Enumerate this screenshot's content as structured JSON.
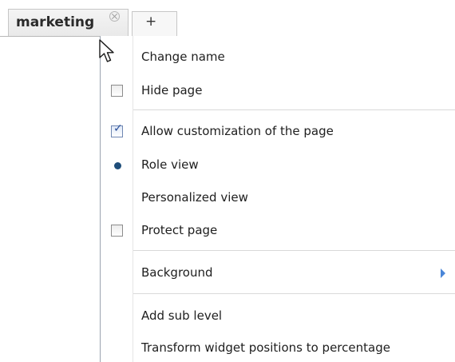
{
  "tabs": {
    "active_label": "marketing",
    "add_label": "+"
  },
  "menu": {
    "items": {
      "change_name": "Change name",
      "hide_page": "Hide page",
      "allow_customization": "Allow customization of the page",
      "role_view": "Role view",
      "personalized_view": "Personalized view",
      "protect_page": "Protect page",
      "background": "Background",
      "add_sub_level": "Add sub level",
      "transform_widget": "Transform widget positions to percentage"
    },
    "state": {
      "hide_page_checked": false,
      "allow_customization_checked": true,
      "role_view_selected": true,
      "protect_page_checked": false
    }
  },
  "colors": {
    "radio_dot": "#1f4e7a",
    "submenu_arrow": "#4a86d8",
    "checkmark": "#2a4f9a"
  },
  "icons": {
    "tab_close": "close-circle-icon",
    "cursor": "arrow-cursor-icon",
    "submenu": "chevron-right-icon",
    "check": "checkmark-icon"
  }
}
